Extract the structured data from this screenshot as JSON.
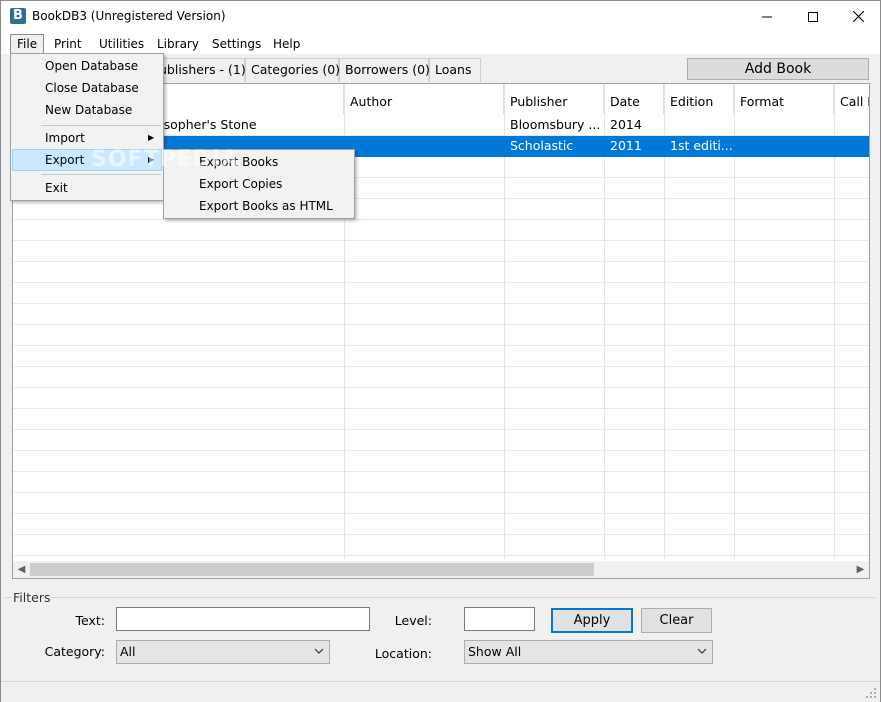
{
  "window": {
    "title": "BookDB3 (Unregistered Version)",
    "icon_letter": "B"
  },
  "menubar": {
    "items": [
      "File",
      "Print",
      "Utilities",
      "Library",
      "Settings",
      "Help"
    ]
  },
  "tabs": [
    {
      "label": "ublishers - (1)"
    },
    {
      "label": "Categories (0)"
    },
    {
      "label": "Borrowers (0)"
    },
    {
      "label": "Loans"
    }
  ],
  "toolbar": {
    "add_book_label": "Add Book"
  },
  "grid": {
    "columns": [
      "Author",
      "Publisher",
      "Date",
      "Edition",
      "Format",
      "Call N"
    ],
    "rows": [
      {
        "title": "osopher's Stone",
        "author": "",
        "publisher": "Bloomsbury ...",
        "date": "2014",
        "edition": "",
        "format": "",
        "call": ""
      },
      {
        "title": "",
        "author": "",
        "publisher": "Scholastic",
        "date": "2011",
        "edition": "1st editi...",
        "format": "",
        "call": ""
      }
    ]
  },
  "file_menu": {
    "items": [
      "Open Database",
      "Close Database",
      "New Database",
      "Import",
      "Export",
      "Exit"
    ]
  },
  "export_submenu": {
    "items": [
      "Export Books",
      "Export Copies",
      "Export Books as HTML"
    ]
  },
  "watermark": {
    "text": "SOFTPEDIA"
  },
  "filters": {
    "legend": "Filters",
    "text_label": "Text:",
    "text_value": "",
    "level_label": "Level:",
    "level_value": "",
    "category_label": "Category:",
    "category_value": "All",
    "location_label": "Location:",
    "location_value": "Show All",
    "apply_label": "Apply",
    "clear_label": "Clear"
  },
  "colors": {
    "selection": "#0078d7",
    "menu_highlight": "#cce8ff"
  }
}
